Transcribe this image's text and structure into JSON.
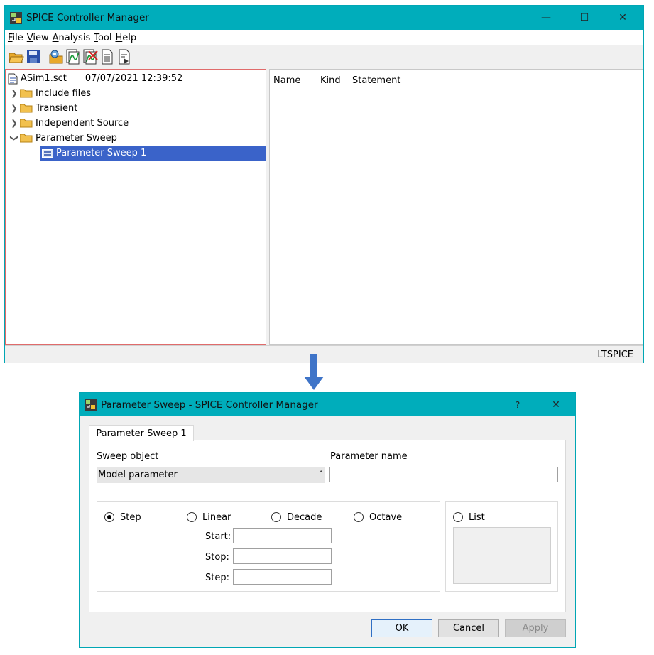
{
  "main_window": {
    "title": "SPICE Controller Manager",
    "controls": {
      "minimize": "—",
      "maximize": "☐",
      "close": "✕"
    },
    "menu": [
      {
        "accel": "F",
        "rest": "ile"
      },
      {
        "accel": "V",
        "rest": "iew"
      },
      {
        "accel": "A",
        "rest": "nalysis"
      },
      {
        "accel": "T",
        "rest": "ool"
      },
      {
        "accel": "H",
        "rest": "elp"
      }
    ],
    "tree": {
      "root_file": "ASim1.sct",
      "root_timestamp": "07/07/2021 12:39:52",
      "items": [
        {
          "label": "Include files",
          "expanded": false
        },
        {
          "label": "Transient",
          "expanded": false
        },
        {
          "label": "Independent Source",
          "expanded": false
        },
        {
          "label": "Parameter Sweep",
          "expanded": true
        }
      ],
      "selected_child": "Parameter Sweep 1"
    },
    "list_columns": [
      "Name",
      "Kind",
      "Statement"
    ],
    "status": "LTSPICE"
  },
  "dialog": {
    "title": "Parameter Sweep - SPICE Controller Manager",
    "help": "?",
    "close": "✕",
    "tab_label": "Parameter Sweep 1",
    "sweep_object_label": "Sweep object",
    "sweep_object_value": "Model parameter",
    "parameter_name_label": "Parameter name",
    "parameter_name_value": "",
    "radios": {
      "step": "Step",
      "linear": "Linear",
      "decade": "Decade",
      "octave": "Octave",
      "list": "List",
      "selected": "Step"
    },
    "fields": {
      "start_label": "Start:",
      "stop_label": "Stop:",
      "step_label": "Step:"
    },
    "buttons": {
      "ok": "OK",
      "cancel": "Cancel",
      "apply_accel": "A",
      "apply_rest": "pply"
    }
  },
  "colors": {
    "titlebar": "#00adbb",
    "selection": "#3a63c9",
    "arrow": "#3f74c8"
  }
}
